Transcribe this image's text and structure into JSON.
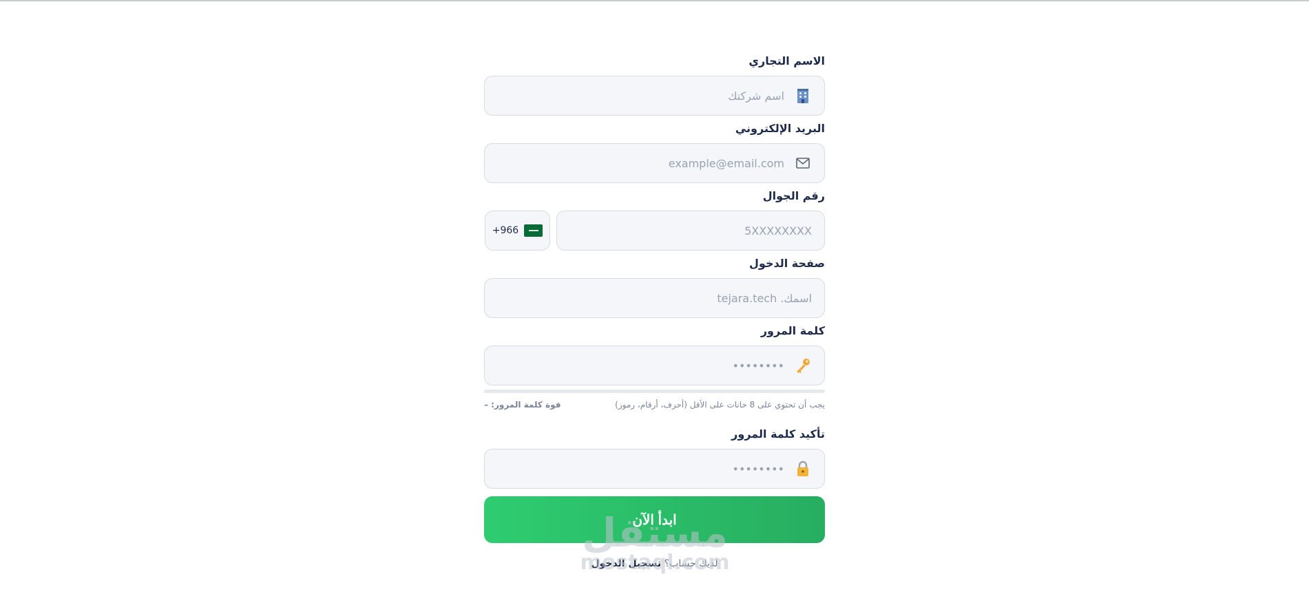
{
  "form": {
    "company_name": {
      "label": "الاسم التجاري",
      "placeholder": "اسم شركتك",
      "icon": "building-icon"
    },
    "email": {
      "label": "البريد الإلكتروني",
      "placeholder": "example@email.com",
      "icon": "envelope-icon"
    },
    "phone": {
      "label": "رقم الجوال",
      "placeholder": "5XXXXXXXX",
      "country_code": "+966",
      "flag_icon": "saudi-flag-icon"
    },
    "login_page": {
      "label": "صفحة الدخول",
      "placeholder": "اسمك. tejara.tech"
    },
    "password": {
      "label": "كلمة المرور",
      "placeholder": "••••••••",
      "icon": "key-icon",
      "hint": "يجب أن تحتوي على 8 خانات على الأقل (أحرف، أرقام، رموز)",
      "strength_label": "قوة كلمة المرور: –"
    },
    "confirm_password": {
      "label": "تأكيد كلمة المرور",
      "placeholder": "••••••••",
      "icon": "lock-icon"
    },
    "submit_label": "ابدأ الآن",
    "login_prompt": "لديك حساب؟",
    "login_link": "تسجيل الدخول"
  },
  "watermark": {
    "arabic": "مستقل",
    "latin": "mostaql.com"
  },
  "colors": {
    "accent": "#2ecc71",
    "accent_dark": "#27ae60",
    "text": "#1e2a4a",
    "placeholder": "#98a2b3"
  }
}
